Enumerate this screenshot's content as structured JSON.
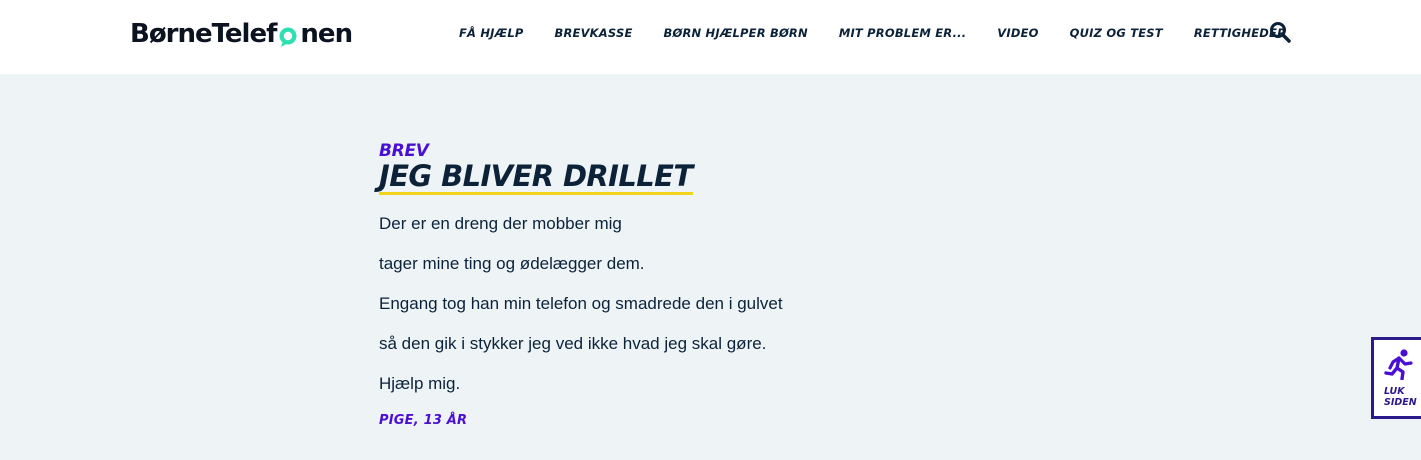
{
  "header": {
    "logo": {
      "part1": "BørneTelef",
      "part2": "nen"
    },
    "nav": [
      "FÅ HJÆLP",
      "BREVKASSE",
      "BØRN HJÆLPER BØRN",
      "MIT PROBLEM ER...",
      "VIDEO",
      "QUIZ OG TEST",
      "RETTIGHEDER"
    ],
    "search_icon": "search-icon"
  },
  "article": {
    "kicker": "BREV",
    "title": "JEG BLIVER DRILLET",
    "paragraphs": [
      "Der er en dreng der mobber mig",
      "tager mine ting og ødelægger dem.",
      "Engang tog han min telefon og smadrede den i gulvet",
      "så den gik i stykker jeg ved ikke hvad jeg skal gøre.",
      "Hjælp mig."
    ],
    "signature": "PIGE, 13 ÅR"
  },
  "exit_button": {
    "line1": "LUK",
    "line2": "SIDEN",
    "icon": "running-person-icon"
  },
  "colors": {
    "accent_purple": "#4a0fd4",
    "title_navy": "#0b2239",
    "underline_yellow": "#f3d31c",
    "logo_green": "#2ee0b0",
    "background": "#eef3f6"
  }
}
